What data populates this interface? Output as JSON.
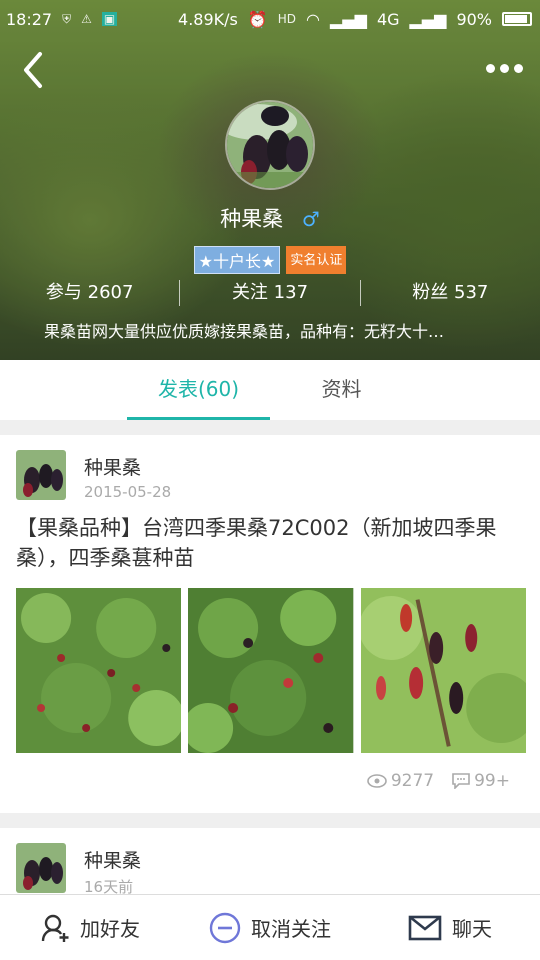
{
  "status_bar": {
    "time": "18:27",
    "speed": "4.89K/s",
    "network": "4G",
    "battery": "90%"
  },
  "profile": {
    "name": "种果桑",
    "gender_symbol": "♂",
    "badge_rank": "★十户长★",
    "badge_verified": "实名认证",
    "stats": [
      {
        "label": "参与",
        "value": "2607"
      },
      {
        "label": "关注",
        "value": "137"
      },
      {
        "label": "粉丝",
        "value": "537"
      }
    ],
    "bio": "果桑苗网大量供应优质嫁接果桑苗，品种有：无籽大十…"
  },
  "tabs": [
    {
      "label": "发表(60)",
      "active": true
    },
    {
      "label": "资料",
      "active": false
    }
  ],
  "posts": [
    {
      "author": "种果桑",
      "date": "2015-05-28",
      "title": "【果桑品种】台湾四季果桑72C002（新加坡四季果桑），四季桑葚种苗",
      "views": "9277",
      "comments": "99+"
    },
    {
      "author": "种果桑",
      "date": "16天前"
    }
  ],
  "bottom_bar": {
    "add_friend": "加好友",
    "unfollow": "取消关注",
    "chat": "聊天"
  },
  "colors": {
    "accent": "#1fb5a9",
    "badge_blue": "#7eaee0",
    "badge_orange": "#f07f2e",
    "gender_blue": "#4db2ff",
    "unfollow_icon": "#6f77d8"
  }
}
